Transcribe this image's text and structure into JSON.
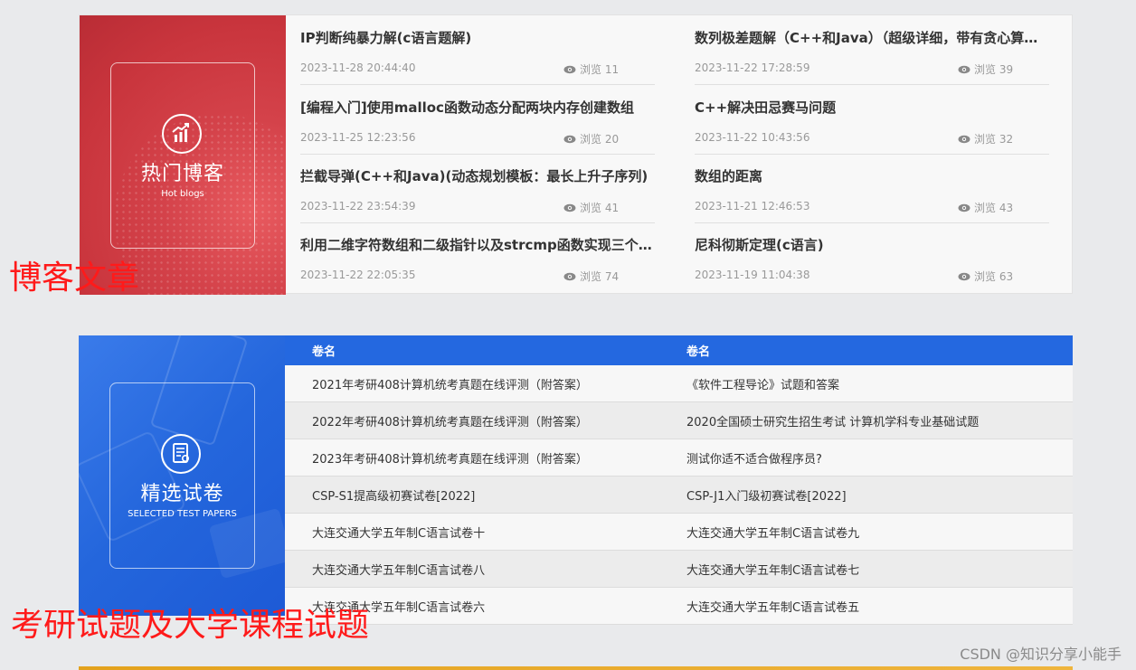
{
  "hot_blogs": {
    "banner": {
      "title": "热门博客",
      "subtitle": "Hot blogs",
      "icon": "chart-growth-icon"
    },
    "items": [
      {
        "title": "IP判断纯暴力解(c语言题解)",
        "date": "2023-11-28 20:44:40",
        "views": "浏览 11"
      },
      {
        "title": "数列极差题解（C++和Java）（超级详细，带有贪心算法详解）",
        "date": "2023-11-22 17:28:59",
        "views": "浏览 39"
      },
      {
        "title": "[编程入门]使用malloc函数动态分配两块内存创建数组",
        "date": "2023-11-25 12:23:56",
        "views": "浏览 20"
      },
      {
        "title": "C++解决田忌赛马问题",
        "date": "2023-11-22 10:43:56",
        "views": "浏览 32"
      },
      {
        "title": "拦截导弹(C++和Java)(动态规划模板：最长上升子序列)",
        "date": "2023-11-22 23:54:39",
        "views": "浏览 41"
      },
      {
        "title": "数组的距离",
        "date": "2023-11-21 12:46:53",
        "views": "浏览 43"
      },
      {
        "title": "利用二维字符数组和二级指针以及strcmp函数实现三个字符串排序",
        "date": "2023-11-22 22:05:35",
        "views": "浏览 74"
      },
      {
        "title": "尼科彻斯定理(c语言)",
        "date": "2023-11-19 11:04:38",
        "views": "浏览 63"
      }
    ]
  },
  "papers": {
    "banner": {
      "title": "精选试卷",
      "subtitle": "SELECTED TEST PAPERS",
      "icon": "document-icon"
    },
    "headers": [
      "卷名",
      "卷名"
    ],
    "rows": [
      [
        "2021年考研408计算机统考真题在线评测（附答案）",
        "《软件工程导论》试题和答案"
      ],
      [
        "2022年考研408计算机统考真题在线评测（附答案）",
        "2020全国硕士研究生招生考试 计算机学科专业基础试题"
      ],
      [
        "2023年考研408计算机统考真题在线评测（附答案）",
        "测试你适不适合做程序员?"
      ],
      [
        "CSP-S1提高级初赛试卷[2022]",
        "CSP-J1入门级初赛试卷[2022]"
      ],
      [
        "大连交通大学五年制C语言试卷十",
        "大连交通大学五年制C语言试卷九"
      ],
      [
        "大连交通大学五年制C语言试卷八",
        "大连交通大学五年制C语言试卷七"
      ],
      [
        "大连交通大学五年制C语言试卷六",
        "大连交通大学五年制C语言试卷五"
      ]
    ]
  },
  "annotations": {
    "blog_label": "博客文章",
    "paper_label": "考研试题及大学课程试题",
    "color": "#ff1a1a"
  },
  "watermark": "CSDN @知识分享小能手",
  "colors": {
    "blog_red": "#d4424a",
    "paper_blue": "#2466dc",
    "stripe_gold": "#e3a21d"
  }
}
